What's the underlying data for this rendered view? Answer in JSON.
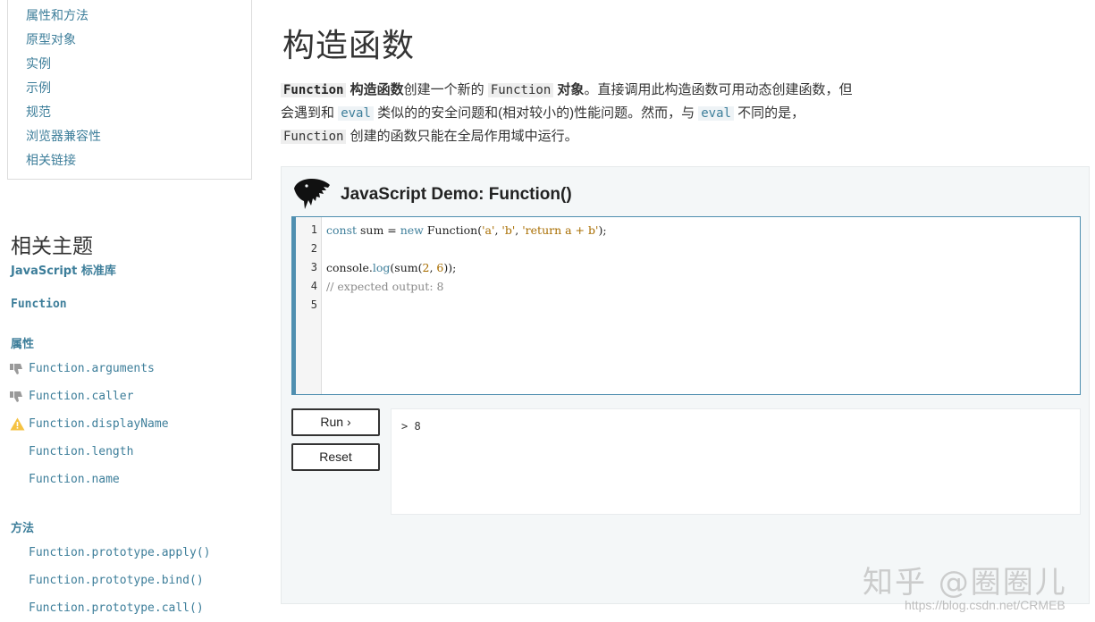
{
  "toc": {
    "items": [
      "属性和方法",
      "原型对象",
      "实例",
      "示例",
      "规范",
      "浏览器兼容性",
      "相关链接"
    ]
  },
  "related": {
    "title": "相关主题",
    "stdlib": "JavaScript 标准库",
    "function": "Function",
    "props_head": "属性",
    "props": [
      "Function.arguments",
      "Function.caller",
      "Function.displayName",
      "Function.length",
      "Function.name"
    ],
    "methods_head": "方法",
    "methods": [
      "Function.prototype.apply()",
      "Function.prototype.bind()",
      "Function.prototype.call()"
    ]
  },
  "main": {
    "title": "构造函数",
    "intro": {
      "c1": "Function",
      "b1": "构造函数",
      "t1": "创建一个新的",
      "c2": "Function",
      "b2": "对象",
      "t2": "。直接调用此构造函数可用动态创建函数，但",
      "t3": "会遇到和",
      "c3": "eval",
      "t4": "类似的的安全问题和(相对较小的)性能问题。然而，与",
      "c4": "eval",
      "t5": "不同的是，",
      "c5": "Function",
      "t6": "创建的函数只能在全局作用域中运行。"
    }
  },
  "demo": {
    "title": "JavaScript Demo: Function()",
    "line_numbers": [
      "1",
      "2",
      "3",
      "4",
      "5"
    ],
    "code": {
      "l1a": "const",
      "l1b": " sum = ",
      "l1c": "new",
      "l1d": " Function(",
      "l1e": "'a'",
      "l1f": ", ",
      "l1g": "'b'",
      "l1h": ", ",
      "l1i": "'return a + b'",
      "l1j": ");",
      "l3a": "console.",
      "l3b": "log",
      "l3c": "(sum(",
      "l3d": "2",
      "l3e": ", ",
      "l3f": "6",
      "l3g": "));",
      "l4": "// expected output: 8"
    },
    "run_label": "Run ›",
    "reset_label": "Reset",
    "output": "> 8"
  },
  "watermark": {
    "text": "知乎 @圈圈儿",
    "url": "https://blog.csdn.net/CRMEB"
  }
}
